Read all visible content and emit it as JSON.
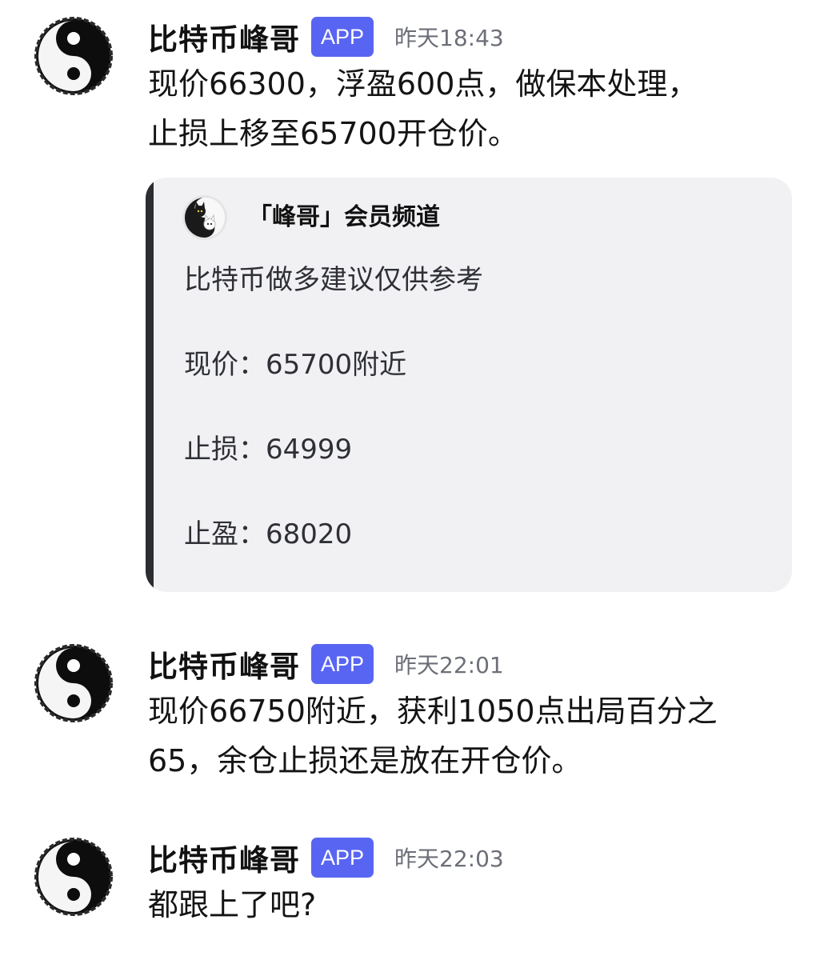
{
  "messages": [
    {
      "author": "比特币峰哥",
      "badge": "APP",
      "timestamp": "昨天18:43",
      "text": "现价66300，浮盈600点，做保本处理，\n止损上移至65700开仓价。",
      "embed": {
        "author": "「峰哥」会员频道",
        "lines": [
          "比特币做多建议仅供参考",
          "现价：65700附近",
          "止损：64999",
          "止盈：68020"
        ]
      }
    },
    {
      "author": "比特币峰哥",
      "badge": "APP",
      "timestamp": "昨天22:01",
      "text": "现价66750附近，获利1050点出局百分之\n65，余仓止损还是放在开仓价。"
    },
    {
      "author": "比特币峰哥",
      "badge": "APP",
      "timestamp": "昨天22:03",
      "text": "都跟上了吧?"
    }
  ],
  "colors": {
    "badge": "#5865f2",
    "timestamp": "#6d6f78",
    "embed_background": "#f1f1f4",
    "embed_bar": "#2b2d31"
  },
  "icons": {
    "avatar": "yin-yang-icon",
    "embed_author_icon": "black-white-cats-icon"
  }
}
